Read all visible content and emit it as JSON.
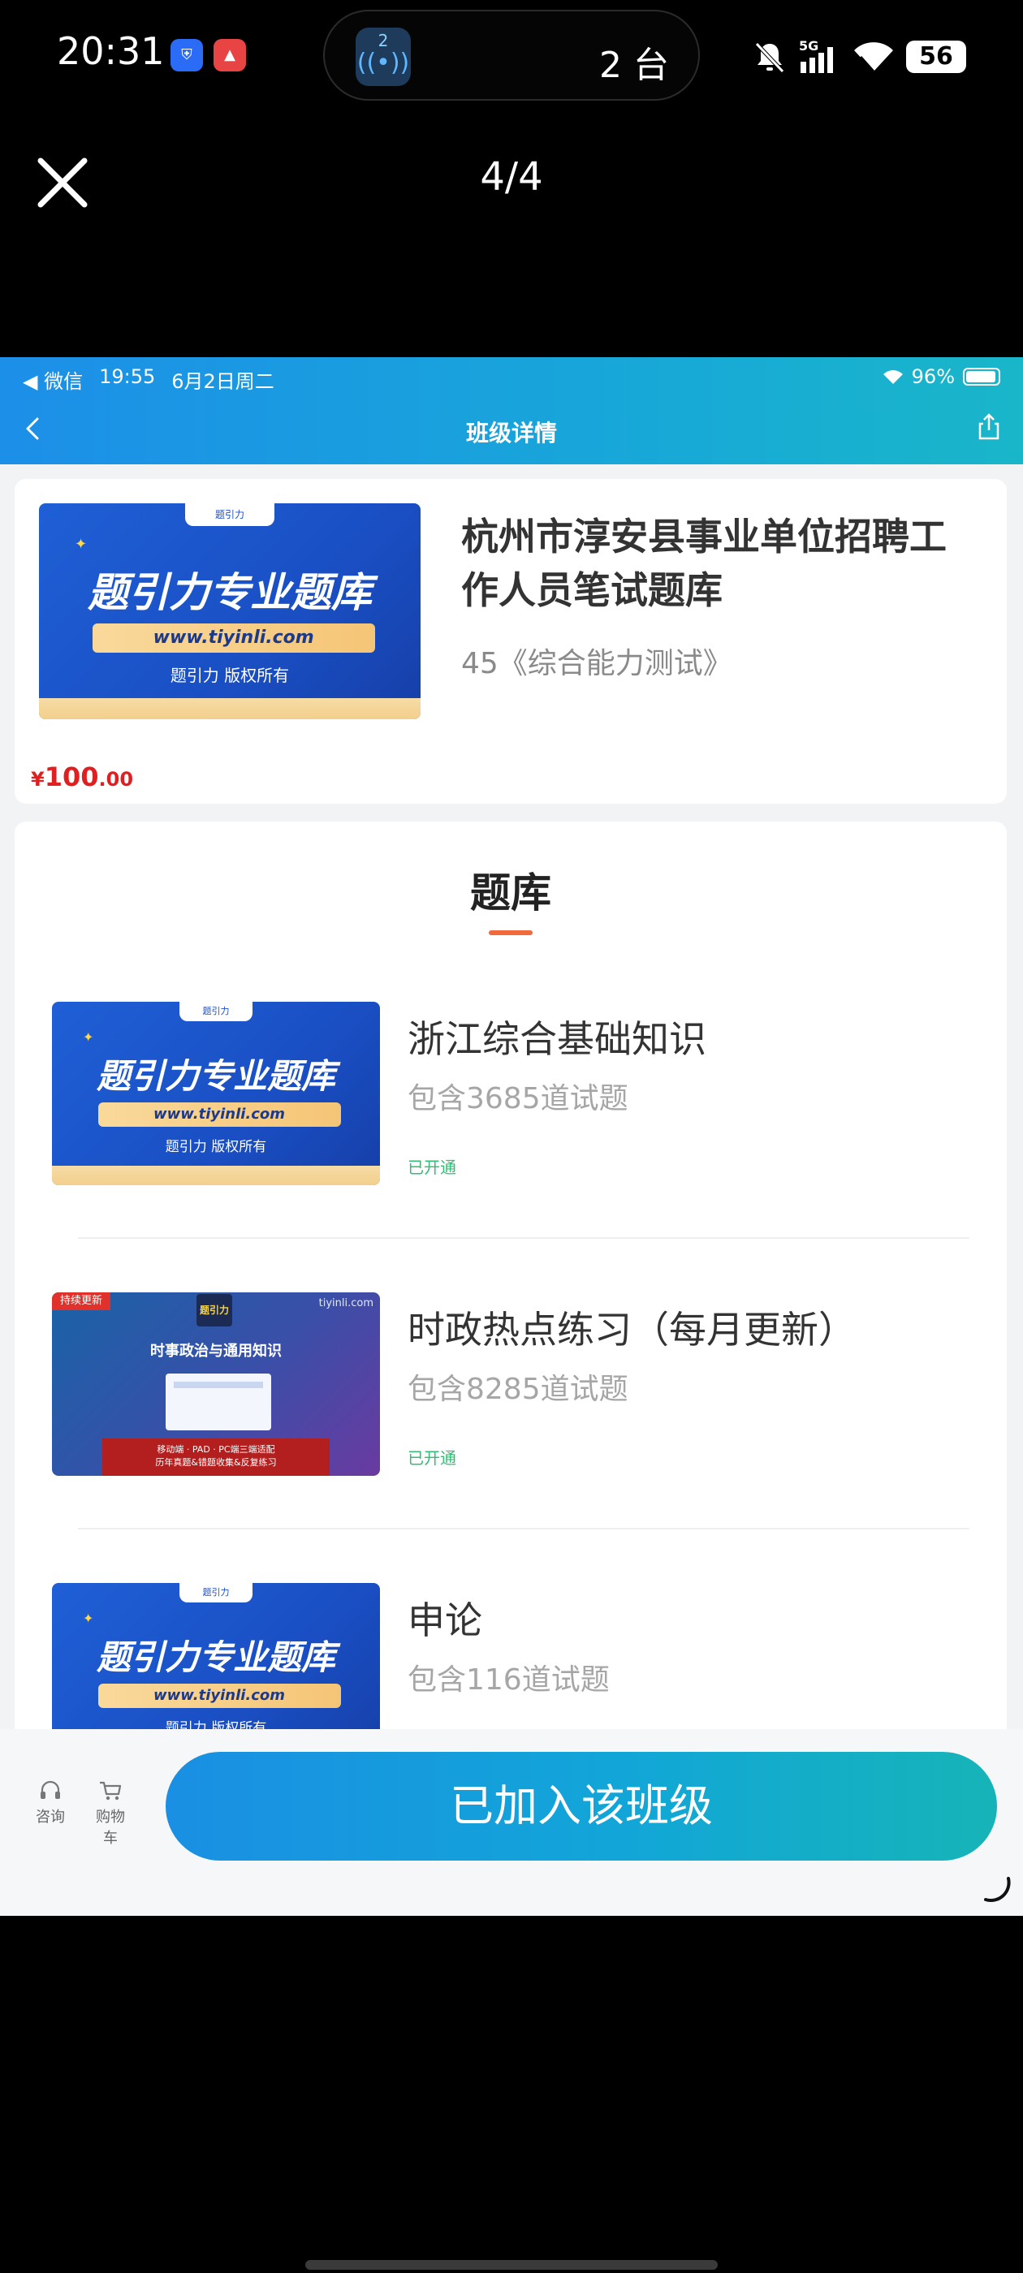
{
  "system_status": {
    "time": "20:31",
    "cast_number": "2",
    "cast_count": "2 台",
    "network": "5G",
    "battery": "56"
  },
  "viewer": {
    "counter": "4/4"
  },
  "ios_status": {
    "back_app": "◀ 微信",
    "time": "19:55",
    "date": "6月2日周二",
    "battery": "96%"
  },
  "nav": {
    "title": "班级详情"
  },
  "course": {
    "title": "杭州市淳安县事业单位招聘工作人员笔试题库",
    "subtitle": "45《综合能力测试》",
    "price_currency": "¥",
    "price_integer": "100",
    "price_decimal": ".00"
  },
  "thumbnail": {
    "brand": "题引力",
    "headline": "题引力专业题库",
    "url": "www.tiyinli.com",
    "copyright": "题引力 版权所有"
  },
  "thumbnail_politics": {
    "tag": "持续更新",
    "logo": "题引力",
    "site": "tiyinli.com",
    "heading": "时事政治与通用知识",
    "banner_line1": "移动端 · PAD · PC端三端适配",
    "banner_line2": "历年真题&错题收集&反复练习"
  },
  "question_bank": {
    "heading": "题库",
    "items": [
      {
        "name": "浙江综合基础知识",
        "count": "包含3685道试题",
        "status": "已开通"
      },
      {
        "name": "时政热点练习（每月更新）",
        "count": "包含8285道试题",
        "status": "已开通"
      },
      {
        "name": "申论",
        "count": "包含116道试题",
        "status": ""
      }
    ]
  },
  "action_bar": {
    "consult_label": "咨询",
    "cart_label": "购物车",
    "join_label": "已加入该班级"
  }
}
